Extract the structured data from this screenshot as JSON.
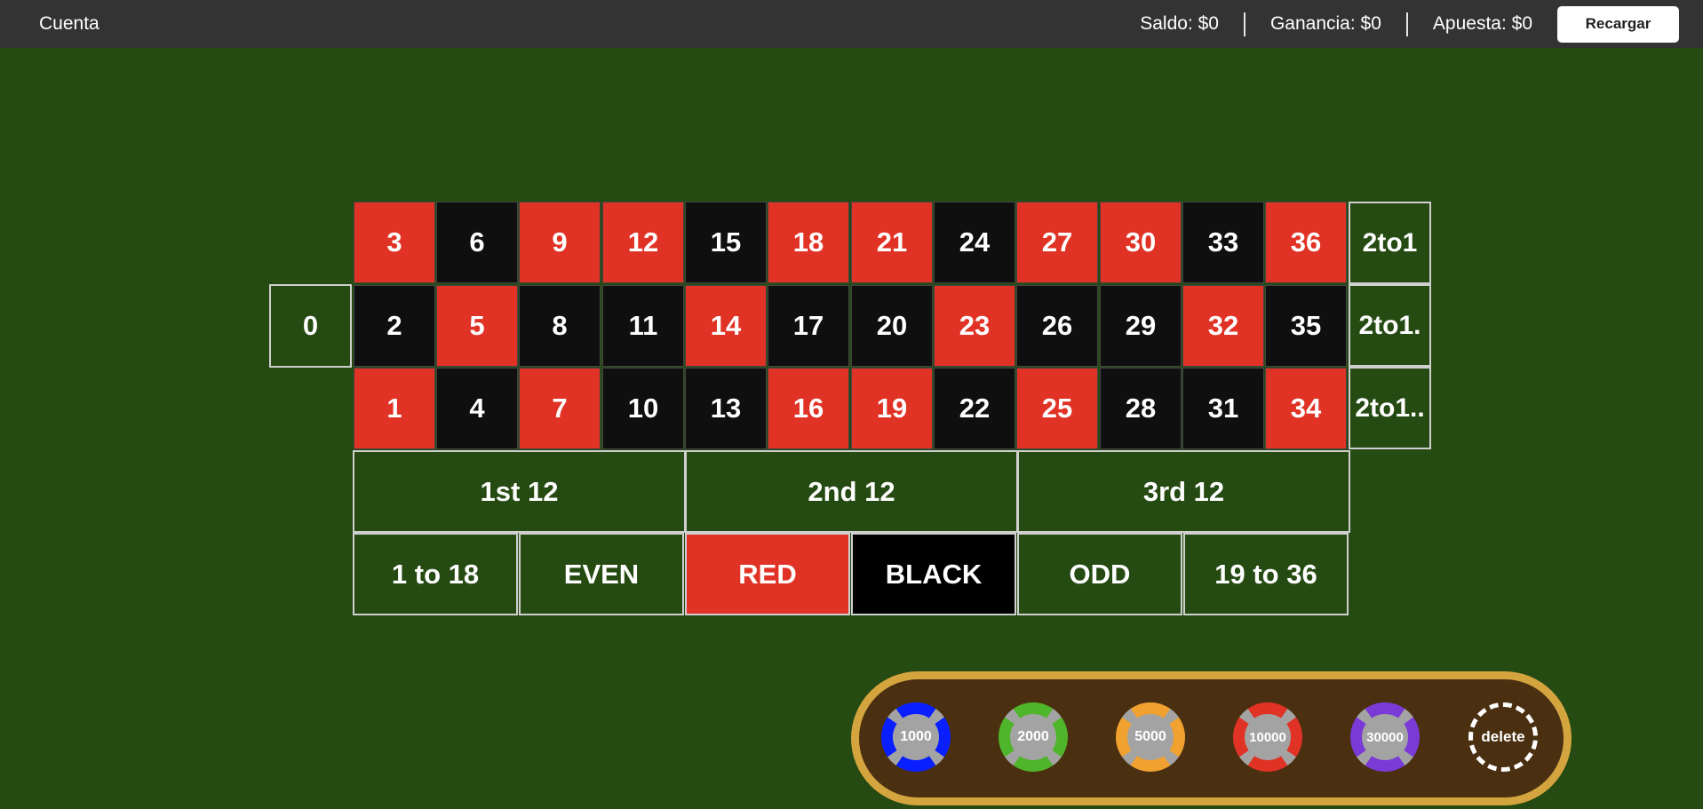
{
  "topbar": {
    "account_label": "Cuenta",
    "balance": "Saldo: $0",
    "winnings": "Ganancia: $0",
    "bet": "Apuesta: $0",
    "reload_label": "Recargar"
  },
  "table": {
    "zero": "0",
    "rows": [
      [
        {
          "n": "3",
          "c": "red"
        },
        {
          "n": "6",
          "c": "black"
        },
        {
          "n": "9",
          "c": "red"
        },
        {
          "n": "12",
          "c": "red"
        },
        {
          "n": "15",
          "c": "black"
        },
        {
          "n": "18",
          "c": "red"
        },
        {
          "n": "21",
          "c": "red"
        },
        {
          "n": "24",
          "c": "black"
        },
        {
          "n": "27",
          "c": "red"
        },
        {
          "n": "30",
          "c": "red"
        },
        {
          "n": "33",
          "c": "black"
        },
        {
          "n": "36",
          "c": "red"
        }
      ],
      [
        {
          "n": "2",
          "c": "black"
        },
        {
          "n": "5",
          "c": "red"
        },
        {
          "n": "8",
          "c": "black"
        },
        {
          "n": "11",
          "c": "black"
        },
        {
          "n": "14",
          "c": "red"
        },
        {
          "n": "17",
          "c": "black"
        },
        {
          "n": "20",
          "c": "black"
        },
        {
          "n": "23",
          "c": "red"
        },
        {
          "n": "26",
          "c": "black"
        },
        {
          "n": "29",
          "c": "black"
        },
        {
          "n": "32",
          "c": "red"
        },
        {
          "n": "35",
          "c": "black"
        }
      ],
      [
        {
          "n": "1",
          "c": "red"
        },
        {
          "n": "4",
          "c": "black"
        },
        {
          "n": "7",
          "c": "red"
        },
        {
          "n": "10",
          "c": "black"
        },
        {
          "n": "13",
          "c": "black"
        },
        {
          "n": "16",
          "c": "red"
        },
        {
          "n": "19",
          "c": "red"
        },
        {
          "n": "22",
          "c": "black"
        },
        {
          "n": "25",
          "c": "red"
        },
        {
          "n": "28",
          "c": "black"
        },
        {
          "n": "31",
          "c": "black"
        },
        {
          "n": "34",
          "c": "red"
        }
      ]
    ],
    "columns": [
      "2to1",
      "2to1.",
      "2to1.."
    ],
    "dozens": [
      "1st 12",
      "2nd 12",
      "3rd 12"
    ],
    "outside": [
      "1 to 18",
      "EVEN",
      "RED",
      "BLACK",
      "ODD",
      "19 to 36"
    ]
  },
  "chips": [
    {
      "label": "1000",
      "color": "#0a1fff"
    },
    {
      "label": "2000",
      "color": "#4fb52a"
    },
    {
      "label": "5000",
      "color": "#f0a130"
    },
    {
      "label": "10000",
      "color": "#e03225"
    },
    {
      "label": "30000",
      "color": "#7a3ad6"
    }
  ],
  "delete_label": "delete",
  "colors": {
    "felt": "#254a12",
    "red": "#e03225",
    "black": "#0f0f0f",
    "topbar": "#333333",
    "tray_border": "#d4a43f",
    "tray_fill": "#4a2f11"
  }
}
